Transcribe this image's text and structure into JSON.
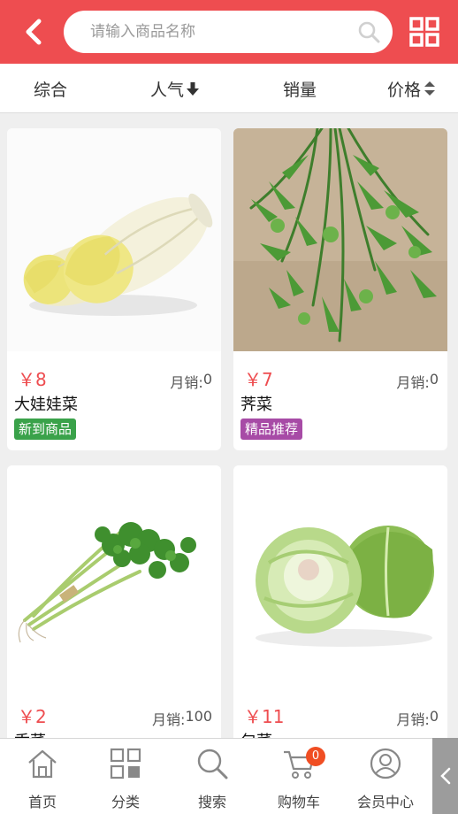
{
  "header": {
    "search_placeholder": "请输入商品名称"
  },
  "sort_tabs": [
    {
      "label": "综合",
      "indicator": "none"
    },
    {
      "label": "人气",
      "indicator": "arrow-down"
    },
    {
      "label": "销量",
      "indicator": "none"
    },
    {
      "label": "价格",
      "indicator": "up-down"
    }
  ],
  "products": [
    {
      "price": "￥8",
      "sales_label": "月销:",
      "sales": "0",
      "name": "大娃娃菜",
      "badge": "新到商品",
      "badge_color": "#3aa24a",
      "image": "napa-cabbage-image"
    },
    {
      "price": "￥7",
      "sales_label": "月销:",
      "sales": "0",
      "name": "荠菜",
      "badge": "精品推荐",
      "badge_color": "#a74ba6",
      "image": "shepherds-purse-image"
    },
    {
      "price": "￥2",
      "sales_label": "月销:",
      "sales": "100",
      "name": "香菜",
      "badge": "",
      "image": "coriander-image"
    },
    {
      "price": "￥11",
      "sales_label": "月销:",
      "sales": "0",
      "name": "包菜",
      "badge": "",
      "image": "cabbage-image"
    }
  ],
  "tabbar": [
    {
      "label": "首页",
      "icon": "home-icon"
    },
    {
      "label": "分类",
      "icon": "category-grid-icon"
    },
    {
      "label": "搜索",
      "icon": "search-icon"
    },
    {
      "label": "购物车",
      "icon": "cart-icon",
      "count": "0"
    },
    {
      "label": "会员中心",
      "icon": "user-icon"
    }
  ],
  "colors": {
    "brand": "#ee4d50",
    "new_badge": "#3aa24a",
    "recommend_badge": "#a74ba6",
    "cart_badge": "#f04e23"
  }
}
